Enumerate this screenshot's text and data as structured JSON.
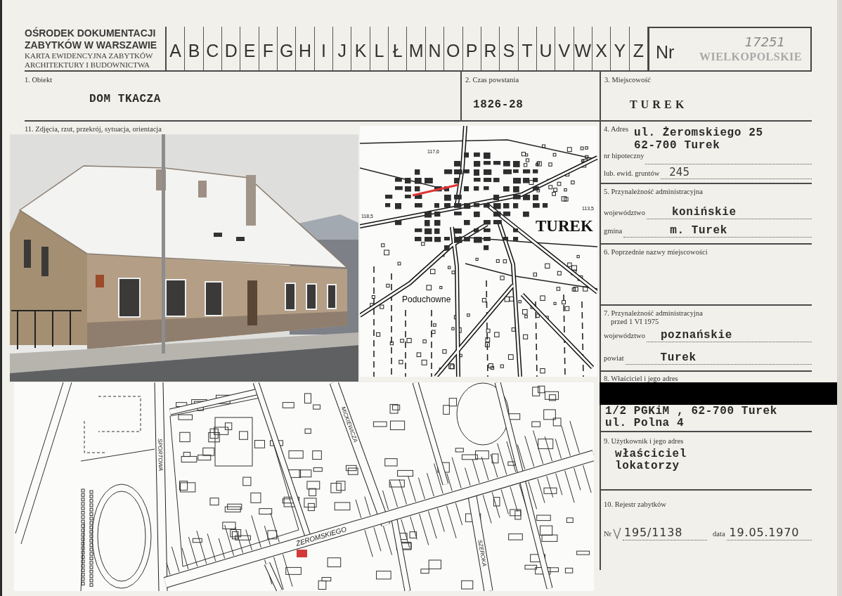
{
  "header": {
    "institution": [
      "OŚRODEK DOKUMENTACJI",
      "ZABYTKÓW W WARSZAWIE"
    ],
    "card_type": [
      "KARTA EWIDENCYJNA ZABYTKÓW",
      "ARCHITEKTURY I BUDOWNICTWA"
    ],
    "index_letters": [
      "A",
      "B",
      "C",
      "D",
      "E",
      "F",
      "G",
      "H",
      "I",
      "J",
      "K",
      "L",
      "Ł",
      "M",
      "N",
      "O",
      "P",
      "R",
      "S",
      "T",
      "U",
      "V",
      "W",
      "X",
      "Y",
      "Z"
    ],
    "number_label": "Nr",
    "number": "17251",
    "region_stamp": "WIELKOPOLSKIE"
  },
  "object": {
    "label": "1. Obiekt",
    "value": "DOM TKACZA"
  },
  "creation_date": {
    "label": "2. Czas powstania",
    "value": "1826-28"
  },
  "locality": {
    "label": "3. Miejscowość",
    "value": "T U R E K"
  },
  "illustrations": {
    "label": "11. Zdjęcia, rzut, przekrój, sytuacja, orientacja",
    "location_map": {
      "labels": [
        {
          "kind": "town",
          "text": "TUREK"
        },
        {
          "kind": "village",
          "text": "Poduchowne"
        },
        {
          "kind": "elevation",
          "text": "117,6"
        },
        {
          "kind": "elevation",
          "text": "118,5"
        },
        {
          "kind": "elevation",
          "text": "113,5"
        }
      ]
    },
    "street_plan": {
      "labels": [
        "ŻEROMSKIEGO",
        "SPORTOWA",
        "MICKIEWICZA",
        "SZEROKA"
      ]
    }
  },
  "address": {
    "label": "4. Adres",
    "lines": [
      "ul. Żeromskiego 25",
      "62-700 Turek"
    ],
    "registry_rows": [
      {
        "label": "nr hipoteczny"
      },
      {
        "label": "lub. ewid. gruntów",
        "value": "245"
      }
    ]
  },
  "administration": {
    "label": "5. Przynależność administracyjna",
    "rows": [
      {
        "label": "województwo",
        "value": "konińskie"
      },
      {
        "label": "gmina",
        "value": "m. Turek"
      }
    ]
  },
  "previous_names": {
    "label": "6. Poprzednie nazwy miejscowości"
  },
  "administration_before_1975": {
    "label": "7. Przynależność administracyjna",
    "sublabel": "przed 1 VI 1975",
    "rows": [
      {
        "label": "województwo",
        "value": "poznańskie"
      },
      {
        "label": "powiat",
        "value": "Turek"
      }
    ]
  },
  "owner": {
    "label": "8. Właściciel i jego adres",
    "lines": [
      "1/2 PGKiM , 62-700 Turek",
      "ul. Polna 4"
    ]
  },
  "user": {
    "label": "9. Użytkownik i jego adres",
    "lines": [
      "właściciel",
      "lokatorzy"
    ]
  },
  "register": {
    "label": "10. Rejestr zabytków",
    "number_label": "Nr",
    "number": "195/1138",
    "date_label": "data",
    "date": "19.05.1970"
  }
}
